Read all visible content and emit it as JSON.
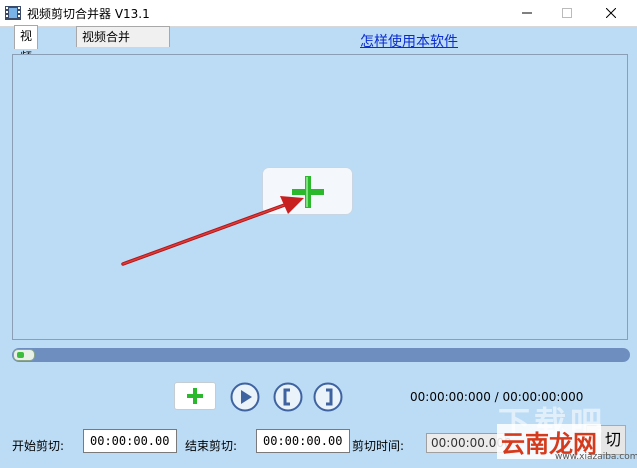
{
  "window": {
    "title": "视频剪切合并器 V13.1",
    "minimize_icon": "minimize-icon",
    "maximize_icon": "maximize-icon",
    "close_icon": "close-icon"
  },
  "tabs": [
    {
      "label": "视频剪切",
      "active": true
    },
    {
      "label": "视频合并",
      "active": false
    }
  ],
  "help_link": "怎样使用本软件",
  "video_area": {
    "add_icon": "plus-icon",
    "arrow": "red-arrow"
  },
  "progress": {
    "value": 0
  },
  "controls": {
    "add_icon": "plus-icon",
    "play_icon": "play-icon",
    "mark_start_icon": "bracket-left-icon",
    "mark_end_icon": "bracket-right-icon",
    "time_readout": "00:00:00:000 / 00:00:00:000"
  },
  "cut": {
    "start_label": "开始剪切:",
    "start_value": "00:00:00.000",
    "end_label": "结束剪切:",
    "end_value": "00:00:00.000",
    "duration_label": "剪切时间:",
    "duration_value": "00:00:00.000",
    "cut_button_partial": "切"
  },
  "watermark": {
    "text": "云南龙网",
    "faint": "下载吧",
    "url": "www.xiazaiba.com"
  },
  "colors": {
    "accent_green": "#2cb82c",
    "link_blue": "#0b2ccf",
    "progress_blue": "#6f8ec0",
    "arrow_red": "#d42a2a"
  }
}
